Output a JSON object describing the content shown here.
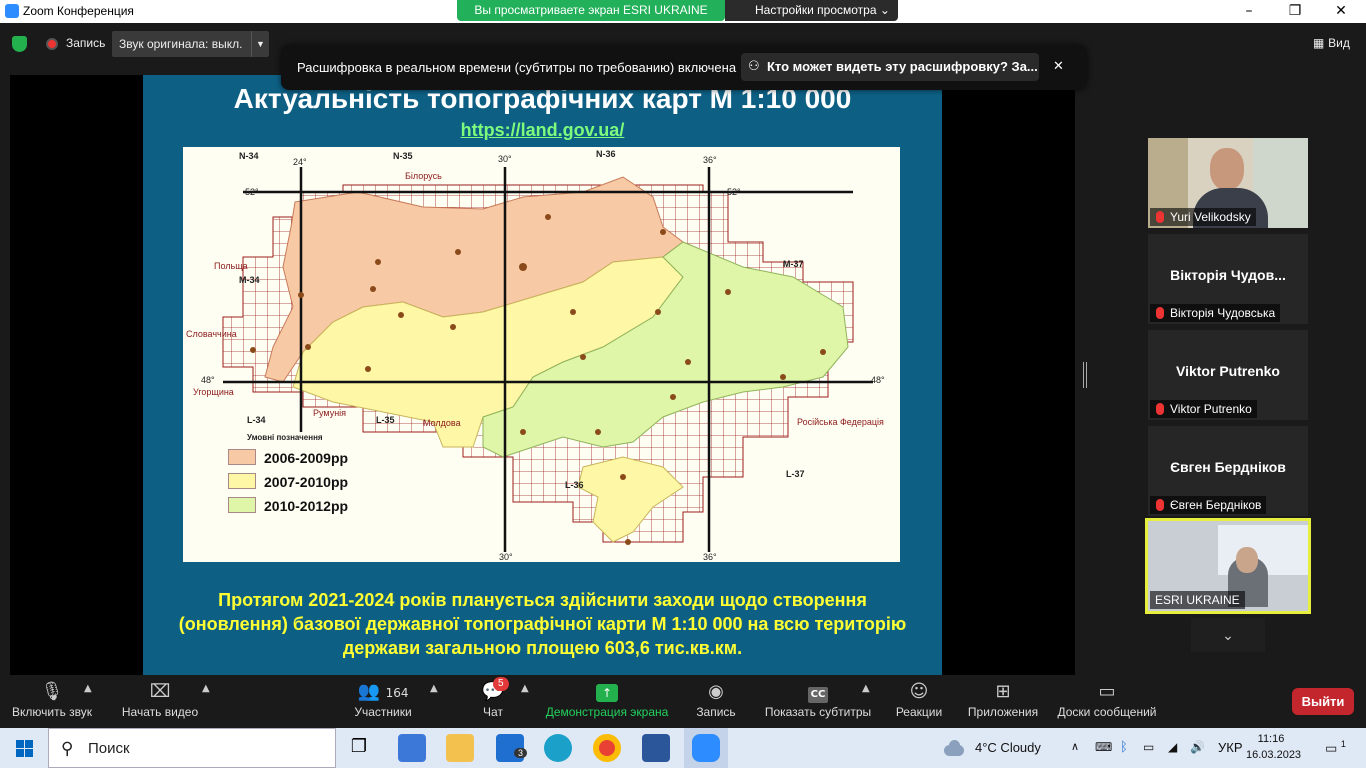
{
  "window": {
    "title": "Zoom Конференция",
    "minimize": "–",
    "maximize": "❐",
    "close": "✕"
  },
  "share_banner": {
    "text": "Вы просматриваете экран ESRI UKRAINE",
    "view_options": "Настройки просмотра ⌄"
  },
  "topbar": {
    "record_label": "Запись",
    "original_sound": "Звук оригинала: выкл.",
    "view_label": "Вид"
  },
  "caption_toast": {
    "message": "Расшифровка в реальном времени (субтитры по требованию) включена",
    "who_can_see": "Кто может видеть эту расшифровку? За...",
    "close": "✕"
  },
  "slide": {
    "title": "Актуальність топографічних карт М 1:10 000",
    "link": "https://land.gov.ua/",
    "footer_text": "Протягом 2021-2024 років планується здійснити заходи щодо створення (оновлення) базової державної топографічної карти М 1:10 000 на всю територію держави загальною площею 603,6 тис.кв.км."
  },
  "map": {
    "sheets_top": [
      "N-34",
      "N-35",
      "N-36"
    ],
    "sheets_right": [
      "M-37",
      "L-37"
    ],
    "sheets_left": [
      "M-34",
      "L-34",
      "L-35"
    ],
    "sheet_l36": "L-36",
    "degrees_top": [
      "24°",
      "30°",
      "36°"
    ],
    "degrees_bottom": [
      "30°",
      "36°"
    ],
    "lat_52_left": "52°",
    "lat_52_right": "52°",
    "lat_48_left": "48°",
    "lat_48_right": "48°",
    "countries": {
      "belarus": "Білорусь",
      "poland": "Польща",
      "slovakia": "Словаччина",
      "hungary": "Угорщина",
      "romania": "Румунія",
      "moldova": "Молдова",
      "russia": "Російська Федерація"
    },
    "legend_title": "Умовні позначення",
    "legend": [
      {
        "label": "2006-2009рр",
        "color": "#f7c9a4"
      },
      {
        "label": "2007-2010рр",
        "color": "#fdf7a6"
      },
      {
        "label": "2010-2012рр",
        "color": "#dff5a8"
      }
    ]
  },
  "participants_panel": {
    "tiles": [
      {
        "name": "Yuri Velikodsky",
        "big_name": ""
      },
      {
        "name": "Вікторія Чудовська",
        "big_name": "Вікторія  Чудов..."
      },
      {
        "name": "Viktor Putrenko",
        "big_name": "Viktor Putrenko"
      },
      {
        "name": "Євген Бердніков",
        "big_name": "Євген Бердніков"
      },
      {
        "name": "ESRI UKRAINE",
        "big_name": ""
      }
    ],
    "scroll_down": "⌄"
  },
  "controls": {
    "unmute": "Включить звук",
    "start_video": "Начать видео",
    "participants": "Участники",
    "participants_count": "164",
    "chat": "Чат",
    "chat_badge": "5",
    "share_screen": "Демонстрация экрана",
    "record": "Запись",
    "captions": "Показать субтитры",
    "captions_icon": "CC",
    "reactions": "Реакции",
    "apps": "Приложения",
    "whiteboards": "Доски сообщений",
    "leave": "Выйти"
  },
  "taskbar": {
    "search_placeholder": "Поиск",
    "mail_badge": "3",
    "weather": "4°C  Cloudy",
    "lang": "УКР",
    "time": "11:16",
    "date": "16.03.2023",
    "notifications": "1"
  }
}
